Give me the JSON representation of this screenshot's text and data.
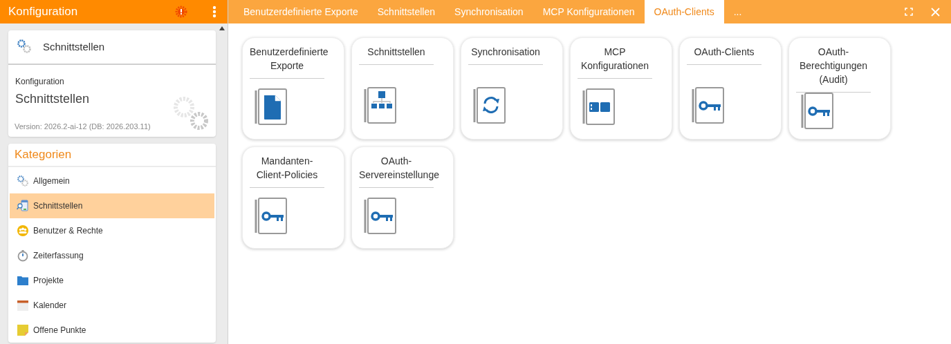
{
  "sidebar": {
    "title": "Konfiguration",
    "current": {
      "label": "Schnittstellen"
    },
    "info": {
      "caption": "Konfiguration",
      "heading": "Schnittstellen",
      "version": "Version: 2026.2-ai-12 (DB: 2026.203.11)"
    },
    "categories_title": "Kategorien",
    "categories": [
      {
        "label": "Allgemein",
        "kind": "gears",
        "selected": false
      },
      {
        "label": "Schnittstellen",
        "kind": "interface",
        "selected": true
      },
      {
        "label": "Benutzer & Rechte",
        "kind": "users",
        "selected": false
      },
      {
        "label": "Zeiterfassung",
        "kind": "stopwatch",
        "selected": false
      },
      {
        "label": "Projekte",
        "kind": "folder",
        "selected": false
      },
      {
        "label": "Kalender",
        "kind": "calendar",
        "selected": false
      },
      {
        "label": "Offene Punkte",
        "kind": "note",
        "selected": false
      }
    ]
  },
  "tabs": [
    {
      "label": "Benutzerdefinierte Exporte",
      "selected": false
    },
    {
      "label": "Schnittstellen",
      "selected": false
    },
    {
      "label": "Synchronisation",
      "selected": false
    },
    {
      "label": "MCP Konfigurationen",
      "selected": false
    },
    {
      "label": "OAuth-Clients",
      "selected": true
    },
    {
      "label": "...",
      "selected": false
    }
  ],
  "tiles": [
    {
      "title": [
        "Benutzerdefinierte",
        "Exporte"
      ],
      "kind": "document"
    },
    {
      "title": [
        "Schnittstellen"
      ],
      "kind": "hierarchy"
    },
    {
      "title": [
        "Synchronisation"
      ],
      "kind": "sync"
    },
    {
      "title": [
        "MCP",
        "Konfigurationen"
      ],
      "kind": "blocks"
    },
    {
      "title": [
        "OAuth-Clients"
      ],
      "kind": "key"
    },
    {
      "title": [
        "OAuth-",
        "Berechtigungen",
        "(Audit)"
      ],
      "kind": "key"
    },
    {
      "title": [
        "Mandanten-",
        "Client-Policies"
      ],
      "kind": "key"
    },
    {
      "title": [
        "OAuth-",
        "Servereinstellunge"
      ],
      "kind": "key"
    }
  ]
}
